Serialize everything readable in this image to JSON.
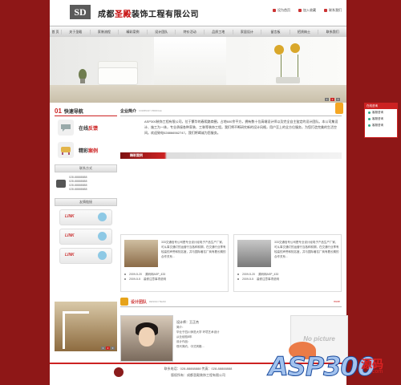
{
  "header": {
    "logo_text": "SD",
    "company_pre": "成都",
    "company_hl": "圣殿",
    "company_post": "装饰工程有限公司",
    "links": [
      "设为首页",
      "加入收藏",
      "联系我们"
    ]
  },
  "nav": {
    "home": "首 页",
    "items": [
      "关于圣殿",
      "家装流程",
      "精彩案例",
      "设计团队",
      "特价活动",
      "品质工地",
      "家居设计",
      "留言板",
      "招贤纳士",
      "联系我们"
    ]
  },
  "banner": {
    "pages": [
      "1",
      "2",
      "3"
    ],
    "active": 2
  },
  "sidebar": {
    "qn_num": "01",
    "qn_title": "快速导航",
    "item1_a": "在线",
    "item1_b": "反馈",
    "item2_a": "精彩",
    "item2_b": "案例",
    "contact_title": "联系方式",
    "phones": [
      "028-88888888",
      "028-88888888",
      "028-88888888",
      "028-88888888"
    ],
    "links_title": "友情链接",
    "link_label": "LINK",
    "photo_pages": [
      "1",
      "2",
      "3"
    ]
  },
  "intro": {
    "title": "企业简介",
    "en": "COMPANY PROFILE",
    "text": "ASP300装饰工程有限公司，位于繁华的春熙路商圈，占地600余平方，拥有数十位高端设计师以及完全自主鉴定的设计团队。本公司集设计、施工为一体，专业承接各种家装、工装等装饰工程。我们将不断研究新的设计风格，用户至上的全方位服务，为您打造完美的生活空间。欢迎致电028866562747，我们将竭诚为您服务。"
  },
  "cases": {
    "title": "精彩案例",
    "cards": [
      {
        "text": "333交通信号公司是专业设计经电子产品生产厂家，可从事交通灯的运营行当各种前期，在交通行业享有较高的声誉和知名度，并与国际著名厂商有着长期的合作关系…",
        "items": [
          {
            "date": "2009-5-20",
            "title": "源码网ASP_433"
          },
          {
            "date": "2009-5-5",
            "title": "装修注意事项说明"
          }
        ]
      },
      {
        "text": "333交通信号公司是专业设计经电子产品生产厂家，可从事交通灯的运营行当各种前期，在交通行业享有较高的声誉和知名度，并与国际著名厂商有着长期的合作关系…",
        "items": [
          {
            "date": "2009-5-20",
            "title": "源码网ASP_433"
          },
          {
            "date": "2009-5-5",
            "title": "装修注意事项说明"
          }
        ]
      }
    ]
  },
  "team": {
    "title": "设计团队",
    "en": "DESIGN TEAM",
    "more": "more",
    "left_text": "计 家装风格，设计理念…  工 流程，建议，步骤，完美，精湛，设计，等…",
    "designer_name": "设计师：王正杰",
    "designer_detail": [
      "简介：",
      "毕业于四川师范大学 环境艺术设计",
      "从业经验8年",
      "设计作品：",
      "现代简约，中式风格…"
    ],
    "nopic": "No picture"
  },
  "footer": {
    "line1": "联系电话：028-88888888  传真：028-88888888",
    "line2": "版权所有：成都圣殿装饰工程有限公司"
  },
  "float": {
    "title": "在线咨询",
    "rows": [
      "客服咨询",
      "客服咨询",
      "客服咨询"
    ]
  },
  "watermark": {
    "text": "ASP300",
    "cn": "源码",
    "com": ".com"
  }
}
